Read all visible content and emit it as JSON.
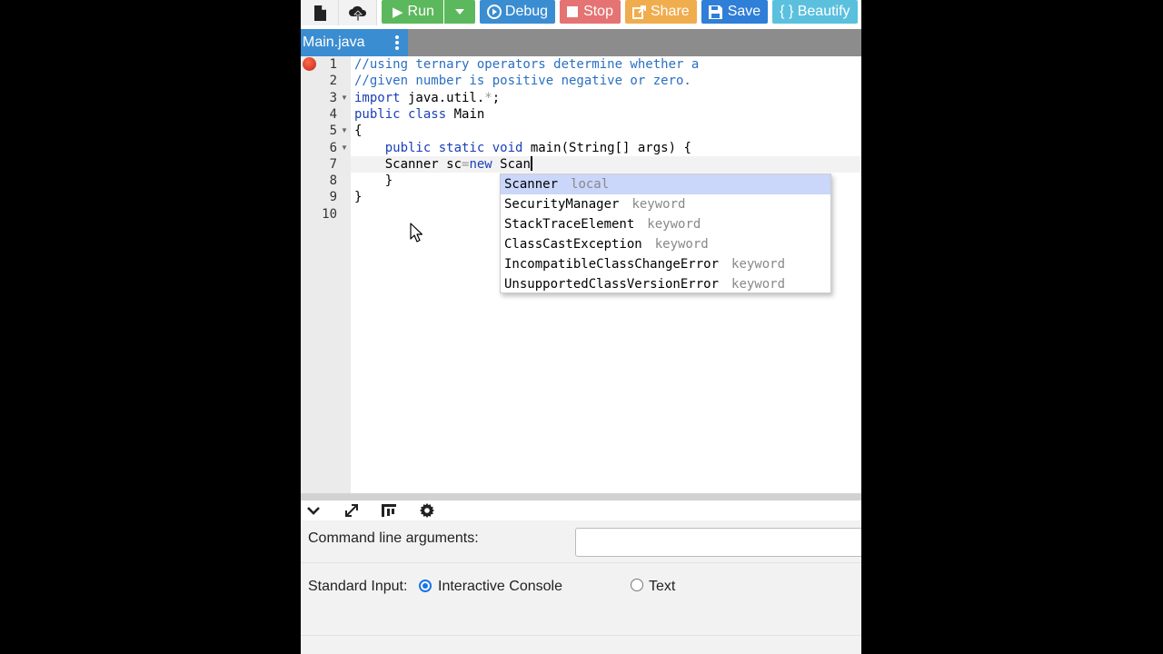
{
  "toolbar": {
    "run_label": "Run",
    "debug_label": "Debug",
    "stop_label": "Stop",
    "share_label": "Share",
    "save_label": "Save",
    "beautify_label": "{ } Beautify"
  },
  "tab": {
    "file_name": "Main.java"
  },
  "editor": {
    "line_numbers": [
      "1",
      "2",
      "3",
      "4",
      "5",
      "6",
      "7",
      "8",
      "9",
      "10"
    ],
    "lines": {
      "l1": "//using ternary operators determine whether a",
      "l2": "//given number is positive negative or zero.",
      "l3_kw": "import",
      "l3_rest": " java.util.",
      "l3_star": "*",
      "l3_end": ";",
      "l4_kw": "public class",
      "l4_rest": " Main",
      "l5": "{",
      "l6_indent": "    ",
      "l6_kw": "public static void",
      "l6_rest": " main(String[] args) {",
      "l7_indent": "    ",
      "l7_a": "Scanner sc",
      "l7_eq": "=",
      "l7_new": "new",
      "l7_b": " Scan",
      "l8": "    }",
      "l9": "}"
    }
  },
  "autocomplete": {
    "items": [
      {
        "name": "Scanner",
        "meta": "local"
      },
      {
        "name": "SecurityManager",
        "meta": "keyword"
      },
      {
        "name": "StackTraceElement",
        "meta": "keyword"
      },
      {
        "name": "ClassCastException",
        "meta": "keyword"
      },
      {
        "name": "IncompatibleClassChangeError",
        "meta": "keyword"
      },
      {
        "name": "UnsupportedClassVersionError",
        "meta": "keyword"
      }
    ]
  },
  "io": {
    "cla_label": "Command line arguments:",
    "cla_value": "",
    "stdin_label": "Standard Input:",
    "option_console": "Interactive Console",
    "option_text": "Text",
    "selected": "Interactive Console"
  },
  "colors": {
    "run": "#5cb85c",
    "debug": "#3b8dd1",
    "stop": "#e57373",
    "share": "#f0ad4e",
    "save": "#2f7ed8",
    "beautify": "#5bc0de"
  }
}
